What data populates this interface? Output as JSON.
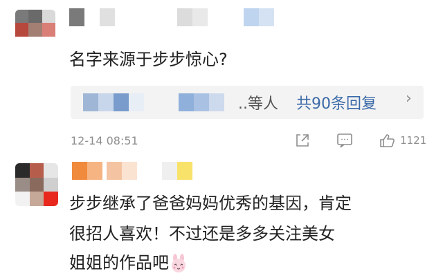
{
  "comments": [
    {
      "text": "名字来源于步步惊心?",
      "replies": {
        "suffix": "..等人",
        "link": "共90条回复",
        "chevron": "›"
      },
      "timestamp": "12-14 08:51",
      "likes": "1121"
    },
    {
      "lines": [
        "步步继承了爸爸妈妈优秀的基因，肯定",
        "很招人喜欢！不过还是多多关注美女",
        "姐姐的作品吧"
      ]
    }
  ],
  "icons": [
    "share-icon",
    "comment-icon",
    "like-icon",
    "rabbit-emoji-icon"
  ],
  "colors": {
    "link": "#3b6aa8",
    "meta": "#8e8e8e",
    "replies_bg": "#f3f3f3"
  }
}
